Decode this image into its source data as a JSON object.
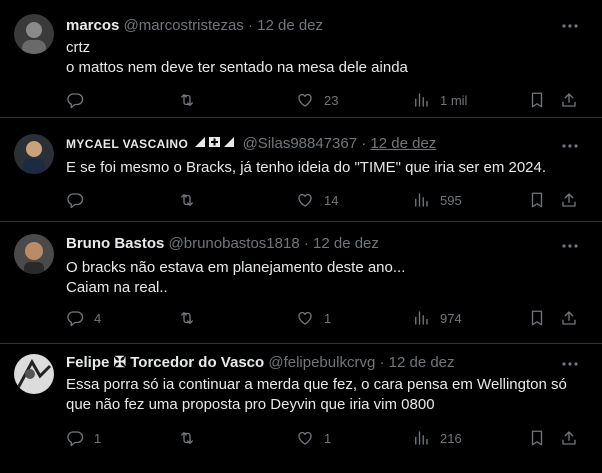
{
  "tweets": [
    {
      "name": "marcos",
      "handle": "@marcostristezas",
      "dot": "·",
      "date": "12 de dez",
      "lines": [
        "crtz",
        "o mattos nem deve ter sentado na mesa dele ainda"
      ],
      "counts": {
        "reply": "",
        "retweet": "",
        "like": "23",
        "views": "1 mil"
      }
    },
    {
      "name": "MYCAEL VASCAINO",
      "handle": "@Silas98847367",
      "dot": "·",
      "date": "12 de dez",
      "lines": [
        "E se foi mesmo o Bracks, já tenho ideia do \"TIME\" que iria ser em 2024."
      ],
      "counts": {
        "reply": "",
        "retweet": "",
        "like": "14",
        "views": "595"
      }
    },
    {
      "name": "Bruno Bastos",
      "handle": "@brunobastos1818",
      "dot": "·",
      "date": "12 de dez",
      "lines": [
        "O bracks não estava em planejamento deste ano...",
        "Caiam na real.."
      ],
      "counts": {
        "reply": "4",
        "retweet": "",
        "like": "1",
        "views": "974"
      }
    },
    {
      "name": "Felipe ✠ Torcedor do Vasco",
      "handle": "@felipebulkcrvg",
      "dot": "·",
      "date": "12 de dez",
      "lines": [
        "Essa porra só ia continuar a merda que fez, o cara pensa em Wellington só",
        "que não fez uma proposta pro Deyvin  que iria vim 0800"
      ],
      "counts": {
        "reply": "1",
        "retweet": "",
        "like": "1",
        "views": "216"
      }
    }
  ],
  "icons": {
    "reply": "reply-icon",
    "retweet": "retweet-icon",
    "like": "like-icon",
    "views": "views-icon",
    "bookmark": "bookmark-icon",
    "share": "share-icon",
    "more": "more-icon"
  },
  "colors": {
    "background": "#000000",
    "text": "#e7e9ea",
    "muted": "#71767b",
    "divider": "#2f3336"
  }
}
